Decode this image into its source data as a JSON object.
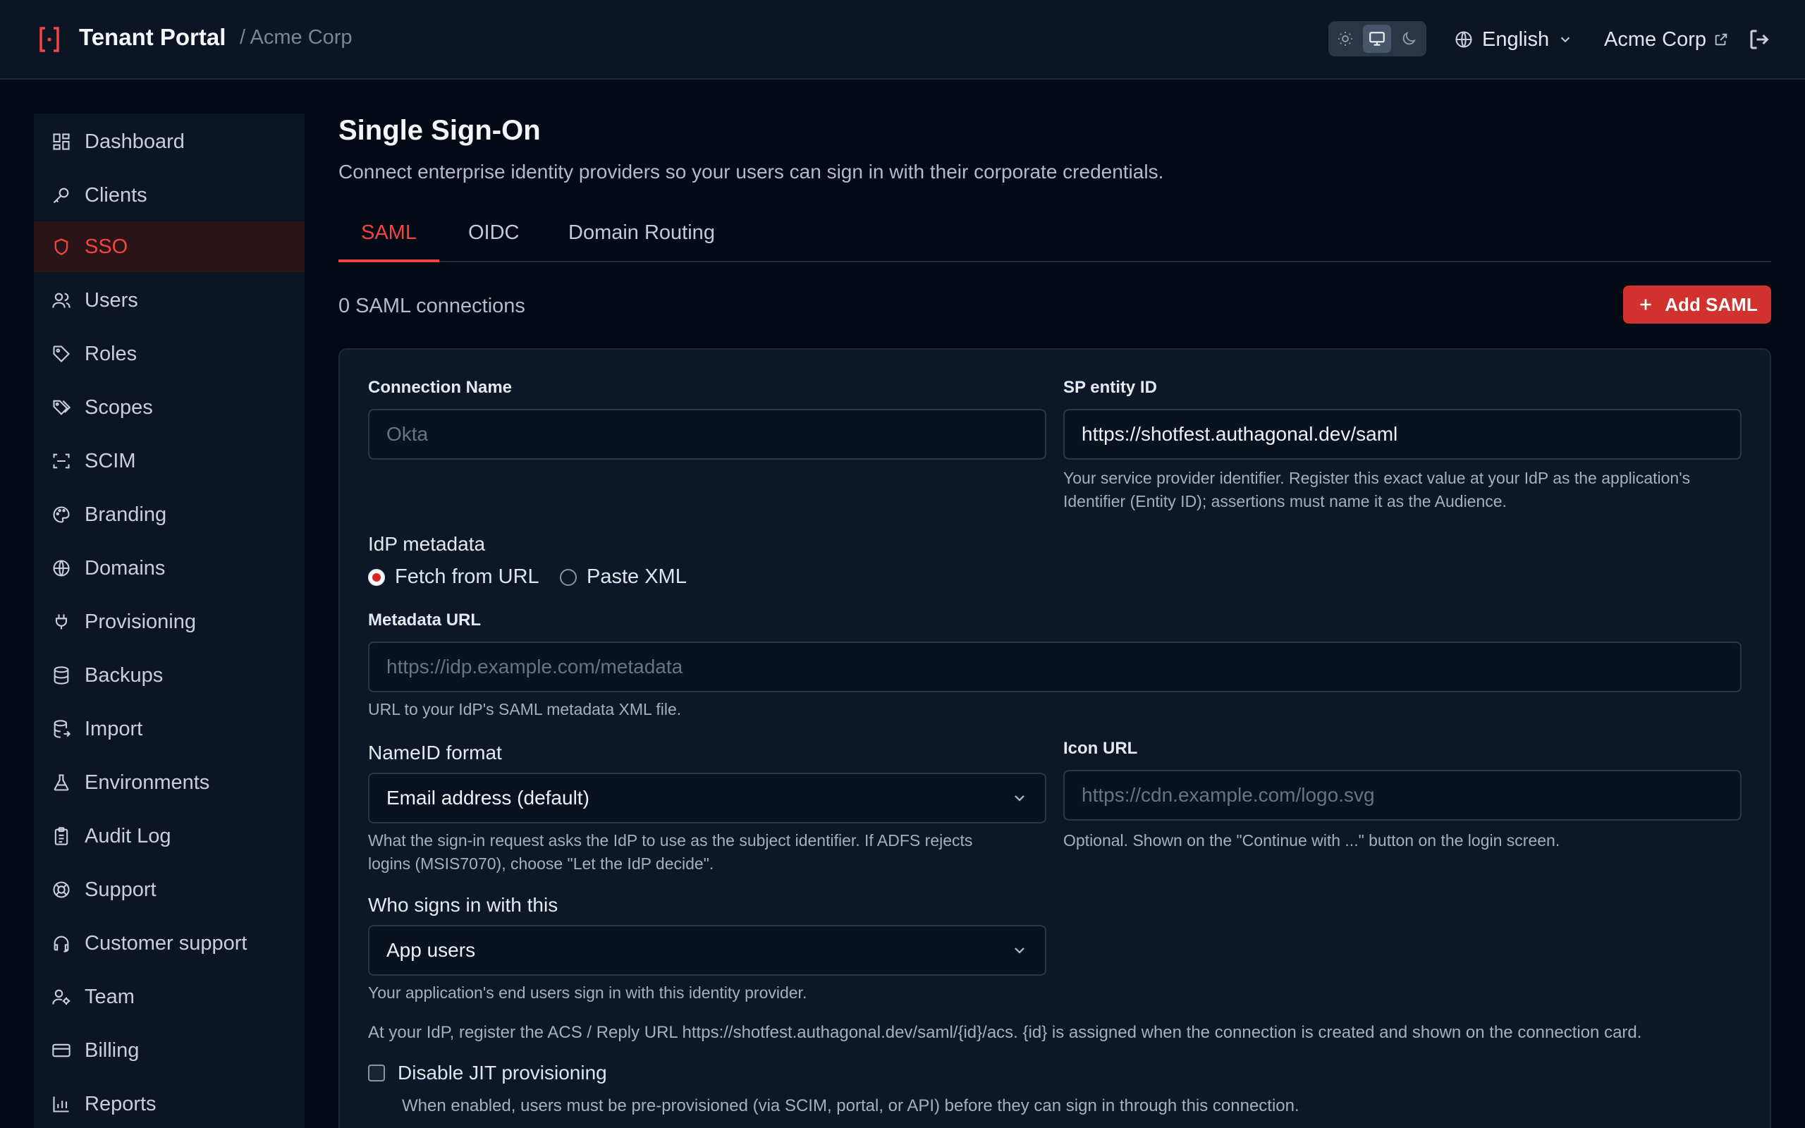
{
  "header": {
    "app_title": "Tenant Portal",
    "tenant_crumb": "/ Acme Corp",
    "language": "English",
    "tenant_link": "Acme Corp"
  },
  "sidebar": {
    "items": [
      {
        "label": "Dashboard",
        "icon": "dashboard-icon"
      },
      {
        "label": "Clients",
        "icon": "key-icon"
      },
      {
        "label": "SSO",
        "icon": "shield-icon",
        "active": true
      },
      {
        "label": "Users",
        "icon": "users-icon"
      },
      {
        "label": "Roles",
        "icon": "tag-icon"
      },
      {
        "label": "Scopes",
        "icon": "tags-icon"
      },
      {
        "label": "SCIM",
        "icon": "scan-icon"
      },
      {
        "label": "Branding",
        "icon": "palette-icon"
      },
      {
        "label": "Domains",
        "icon": "globe-icon"
      },
      {
        "label": "Provisioning",
        "icon": "plug-icon"
      },
      {
        "label": "Backups",
        "icon": "database-icon"
      },
      {
        "label": "Import",
        "icon": "database-import-icon"
      },
      {
        "label": "Environments",
        "icon": "flask-icon"
      },
      {
        "label": "Audit Log",
        "icon": "clipboard-icon"
      },
      {
        "label": "Support",
        "icon": "life-buoy-icon"
      },
      {
        "label": "Customer support",
        "icon": "headset-icon"
      },
      {
        "label": "Team",
        "icon": "team-icon"
      },
      {
        "label": "Billing",
        "icon": "credit-card-icon"
      },
      {
        "label": "Reports",
        "icon": "bar-chart-icon"
      }
    ]
  },
  "page": {
    "title": "Single Sign-On",
    "subtitle": "Connect enterprise identity providers so your users can sign in with their corporate credentials.",
    "tabs": [
      "SAML",
      "OIDC",
      "Domain Routing"
    ],
    "active_tab": "SAML",
    "count_label": "0 SAML connections",
    "add_button": "Add SAML"
  },
  "form": {
    "connection_name": {
      "label": "Connection Name",
      "placeholder": "Okta",
      "value": ""
    },
    "sp_entity": {
      "label": "SP entity ID",
      "value": "https://shotfest.authagonal.dev/saml",
      "help_1": "Your service provider identifier. Register this exact value at your IdP as the application's",
      "help_2": "Identifier (Entity ID); assertions must name it as the Audience."
    },
    "idp_metadata": {
      "label": "IdP metadata",
      "options": [
        "Fetch from URL",
        "Paste XML"
      ],
      "selected": "Fetch from URL"
    },
    "metadata_url": {
      "label": "Metadata URL",
      "placeholder": "https://idp.example.com/metadata",
      "help": "URL to your IdP's SAML metadata XML file."
    },
    "nameid": {
      "label": "NameID format",
      "value": "Email address (default)",
      "help_1": "What the sign-in request asks the IdP to use as the subject identifier. If ADFS rejects",
      "help_2": "logins (MSIS7070), choose \"Let the IdP decide\"."
    },
    "icon_url": {
      "label": "Icon URL",
      "placeholder": "https://cdn.example.com/logo.svg",
      "help": "Optional. Shown on the \"Continue with ...\" button on the login screen."
    },
    "who_signs_in": {
      "label": "Who signs in with this",
      "value": "App users",
      "help": "Your application's end users sign in with this identity provider."
    },
    "acs_note": "At your IdP, register the ACS / Reply URL https://shotfest.authagonal.dev/saml/{id}/acs. {id} is assigned when the connection is created and shown on the connection card.",
    "jit": {
      "label": "Disable JIT provisioning",
      "checked": false,
      "help": "When enabled, users must be pre-provisioned (via SCIM, portal, or API) before they can sign in through this connection."
    }
  },
  "colors": {
    "accent": "#ef4444",
    "primary_button": "#d2322d",
    "background": "#040a15",
    "surface": "#0d1524"
  }
}
